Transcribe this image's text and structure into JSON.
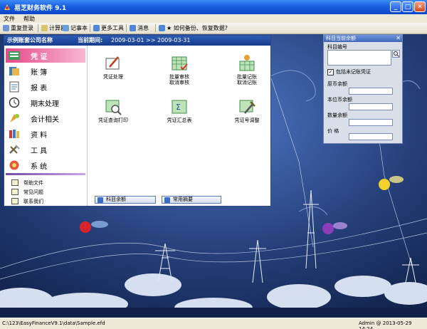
{
  "window": {
    "title": "易芝财务软件 9.1",
    "btn_min": "_",
    "btn_max": "□",
    "btn_close": "✕"
  },
  "menu": [
    "文件",
    "帮助"
  ],
  "toolbar": [
    {
      "label": "重复登录",
      "icon_color": "#6e95d6"
    },
    {
      "label": "计算器",
      "icon_color": "#d9c46a"
    },
    {
      "label": "记事本",
      "icon_color": "#6aa0d9"
    },
    {
      "label": "更多工具",
      "icon_color": "#4f86d6"
    },
    {
      "label": "消息",
      "icon_color": "#4f86d6"
    },
    {
      "label": "★ 如何备份、恢复数据?",
      "icon_color": "#4f86d6"
    }
  ],
  "panel": {
    "company": "示例账套公司名称",
    "period_label": "当前期间:",
    "period_value": "2009-03-01 >> 2009-03-31"
  },
  "nav": [
    {
      "label": "凭 证",
      "icon": "voucher-icon"
    },
    {
      "label": "账 簿",
      "icon": "ledger-icon"
    },
    {
      "label": "报 表",
      "icon": "report-icon"
    },
    {
      "label": "期末处理",
      "icon": "clock-icon"
    },
    {
      "label": "会计相关",
      "icon": "accounting-icon"
    },
    {
      "label": "资 料",
      "icon": "books-icon"
    },
    {
      "label": "工 具",
      "icon": "tools-icon"
    },
    {
      "label": "系 统",
      "icon": "system-icon"
    }
  ],
  "help": [
    "帮助文件",
    "常见问题",
    "联系我们"
  ],
  "functions": [
    {
      "l1": "凭证处理",
      "l2": "",
      "icon": "voucher-edit-icon"
    },
    {
      "l1": "批量审核",
      "l2": "取消审核",
      "icon": "batch-audit-icon"
    },
    {
      "l1": "批量记账",
      "l2": "取消记账",
      "icon": "batch-post-icon"
    },
    {
      "l1": "凭证查询打印",
      "l2": "",
      "icon": "voucher-query-icon"
    },
    {
      "l1": "凭证汇总表",
      "l2": "",
      "icon": "summary-icon"
    },
    {
      "l1": "凭证号调整",
      "l2": "",
      "icon": "renumber-icon"
    }
  ],
  "buttons": {
    "balance": "科目余额",
    "summary": "常用摘要"
  },
  "side": {
    "title": "科目当前余额",
    "close": "✕",
    "account_code": "科目编号",
    "include_unposted": "包括未记账凭证",
    "original_balance": "原币余额",
    "local_balance": "本位币余额",
    "quantity_balance": "数量余额",
    "price": "价 格"
  },
  "status": {
    "path": "C:\\123\\EasyFinanceV9.1\\data\\Sample.efd",
    "user": "Admin @ 2013-05-29 14:24"
  }
}
